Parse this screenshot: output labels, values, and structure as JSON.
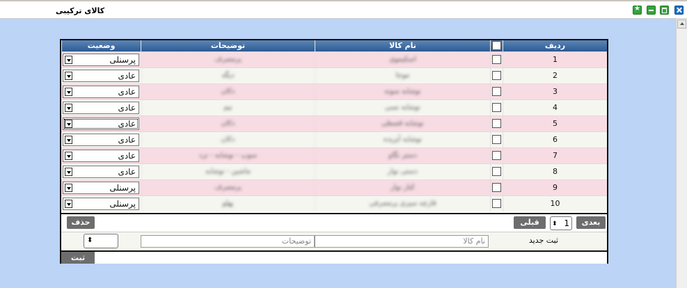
{
  "window": {
    "title": "کالای ترکیبی"
  },
  "table": {
    "headers": {
      "row": "ردیف",
      "name": "نام کالا",
      "desc": "توضیحات",
      "status": "وضعیت"
    },
    "rows": [
      {
        "num": "1",
        "name": "اسکیموی",
        "desc": "پرمصرف",
        "status": "پرسنلی"
      },
      {
        "num": "2",
        "name": "موجا",
        "desc": "دیگه",
        "status": "عادی"
      },
      {
        "num": "3",
        "name": "نوشابه سونه",
        "desc": "دکان",
        "status": "عادی"
      },
      {
        "num": "4",
        "name": "نوشابه نسی",
        "desc": "نیم",
        "status": "عادی"
      },
      {
        "num": "5",
        "name": "نوشابه قصطی",
        "desc": "دکان",
        "status": "عادی"
      },
      {
        "num": "6",
        "name": "نوشابه آیزیده",
        "desc": "دکان",
        "status": "عادی"
      },
      {
        "num": "7",
        "name": "دستر نگاو",
        "desc": "سوپ - نوشابه - ترد",
        "status": "عادی"
      },
      {
        "num": "8",
        "name": "دستی نوار",
        "desc": "ماشین - نوشابه",
        "status": "عادی"
      },
      {
        "num": "9",
        "name": "کنار نوار",
        "desc": "پرمصرف",
        "status": "پرسنلی"
      },
      {
        "num": "10",
        "name": "قارچه سیزی پرمصرفی",
        "desc": "پهلو",
        "status": "پرسنلی"
      }
    ]
  },
  "pager": {
    "next": "بعدی",
    "page": "1",
    "prev": "قبلی",
    "delete": "حذف"
  },
  "new_entry": {
    "label": "ثبت جدید",
    "name_placeholder": "نام کالا",
    "desc_placeholder": "توضیحات"
  },
  "save": {
    "label": "ثبت"
  }
}
